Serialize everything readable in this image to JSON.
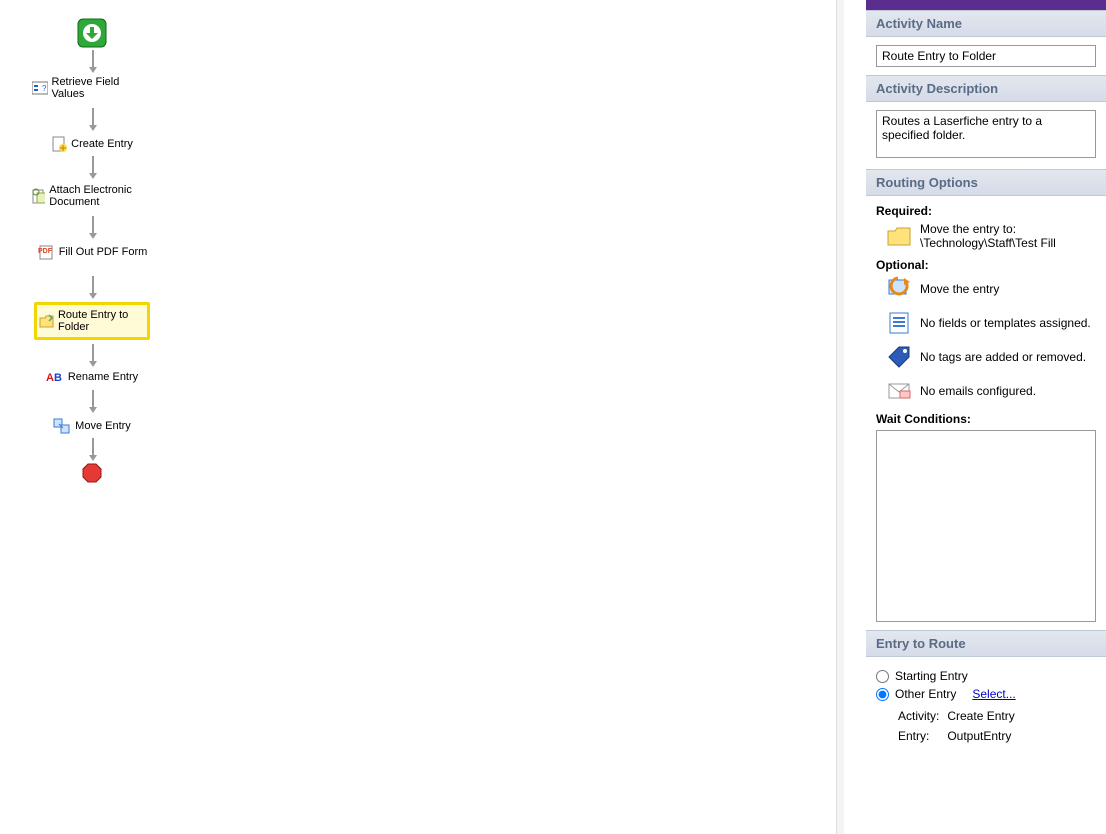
{
  "workflow": {
    "retrieve": "Retrieve Field Values",
    "create": "Create Entry",
    "attach": "Attach Electronic Document",
    "fillpdf": "Fill Out PDF Form",
    "route": "Route Entry to Folder",
    "rename": "Rename Entry",
    "move": "Move Entry"
  },
  "panel": {
    "activity_name_header": "Activity Name",
    "activity_name_value": "Route Entry to Folder",
    "activity_desc_header": "Activity Description",
    "activity_desc_value": "Routes a Laserfiche entry to a specified folder.",
    "routing_header": "Routing Options",
    "required_label": "Required:",
    "required_line1": "Move the entry to:",
    "required_line2": "\\Technology\\Staff\\Test Fill",
    "optional_label": "Optional:",
    "opt_move": "Move the entry",
    "opt_fields": "No fields or templates assigned.",
    "opt_tags": "No tags are added or removed.",
    "opt_emails": "No emails configured.",
    "wait_label": "Wait Conditions:",
    "entry_header": "Entry to Route",
    "radio_starting": "Starting Entry",
    "radio_other": "Other Entry",
    "select_link": "Select...",
    "kv_activity_label": "Activity:",
    "kv_activity_value": "Create Entry",
    "kv_entry_label": "Entry:",
    "kv_entry_value": "OutputEntry"
  }
}
